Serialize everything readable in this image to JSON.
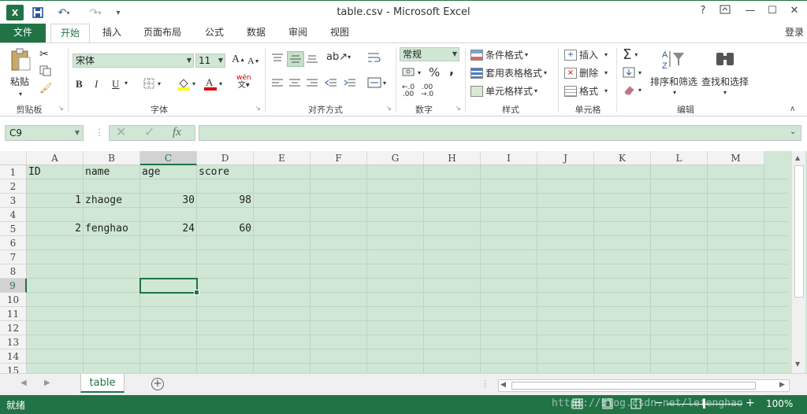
{
  "window": {
    "title": "table.csv - Microsoft Excel",
    "help": "?",
    "login": "登录"
  },
  "tabs": [
    "文件",
    "开始",
    "插入",
    "页面布局",
    "公式",
    "数据",
    "审阅",
    "视图"
  ],
  "ribbon": {
    "clipboard": {
      "paste": "粘贴",
      "group": "剪贴板"
    },
    "font": {
      "name": "宋体",
      "size": "11",
      "group": "字体",
      "grow": "A",
      "shrink": "A",
      "bold": "B",
      "italic": "I",
      "underline": "U",
      "pinyin": "wén"
    },
    "alignment": {
      "group": "对齐方式"
    },
    "number": {
      "format": "常规",
      "group": "数字",
      "percent": "%",
      "comma": ","
    },
    "styles": {
      "conditional": "条件格式",
      "table": "套用表格格式",
      "cell": "单元格样式",
      "group": "样式"
    },
    "cells": {
      "insert": "插入",
      "delete": "删除",
      "format": "格式",
      "group": "单元格"
    },
    "editing": {
      "sort": "排序和筛选",
      "find": "查找和选择",
      "group": "编辑"
    }
  },
  "formula_bar": {
    "name_box": "C9",
    "fx": "fx",
    "value": ""
  },
  "grid": {
    "columns": [
      "A",
      "B",
      "C",
      "D",
      "E",
      "F",
      "G",
      "H",
      "I",
      "J",
      "K",
      "L",
      "M"
    ],
    "rows": [
      "1",
      "2",
      "3",
      "4",
      "5",
      "6",
      "7",
      "8",
      "9",
      "10",
      "11",
      "12",
      "13",
      "14",
      "15"
    ],
    "cells": [
      {
        "row": 1,
        "col": "A",
        "value": "ID"
      },
      {
        "row": 1,
        "col": "B",
        "value": "name"
      },
      {
        "row": 1,
        "col": "C",
        "value": "age"
      },
      {
        "row": 1,
        "col": "D",
        "value": "score"
      },
      {
        "row": 3,
        "col": "A",
        "value": "1"
      },
      {
        "row": 3,
        "col": "B",
        "value": "zhaoge"
      },
      {
        "row": 3,
        "col": "C",
        "value": "30"
      },
      {
        "row": 3,
        "col": "D",
        "value": "98"
      },
      {
        "row": 5,
        "col": "A",
        "value": "2"
      },
      {
        "row": 5,
        "col": "B",
        "value": "fenghao"
      },
      {
        "row": 5,
        "col": "C",
        "value": "24"
      },
      {
        "row": 5,
        "col": "D",
        "value": "60"
      }
    ],
    "selected_cell": "C9"
  },
  "sheets": [
    "table"
  ],
  "status": {
    "mode": "就绪",
    "zoom": "100%",
    "watermark": "https://blog.csdn.net/lefenghao"
  },
  "colors": {
    "accent": "#217346",
    "grid_bg": "#cfe7d4"
  }
}
